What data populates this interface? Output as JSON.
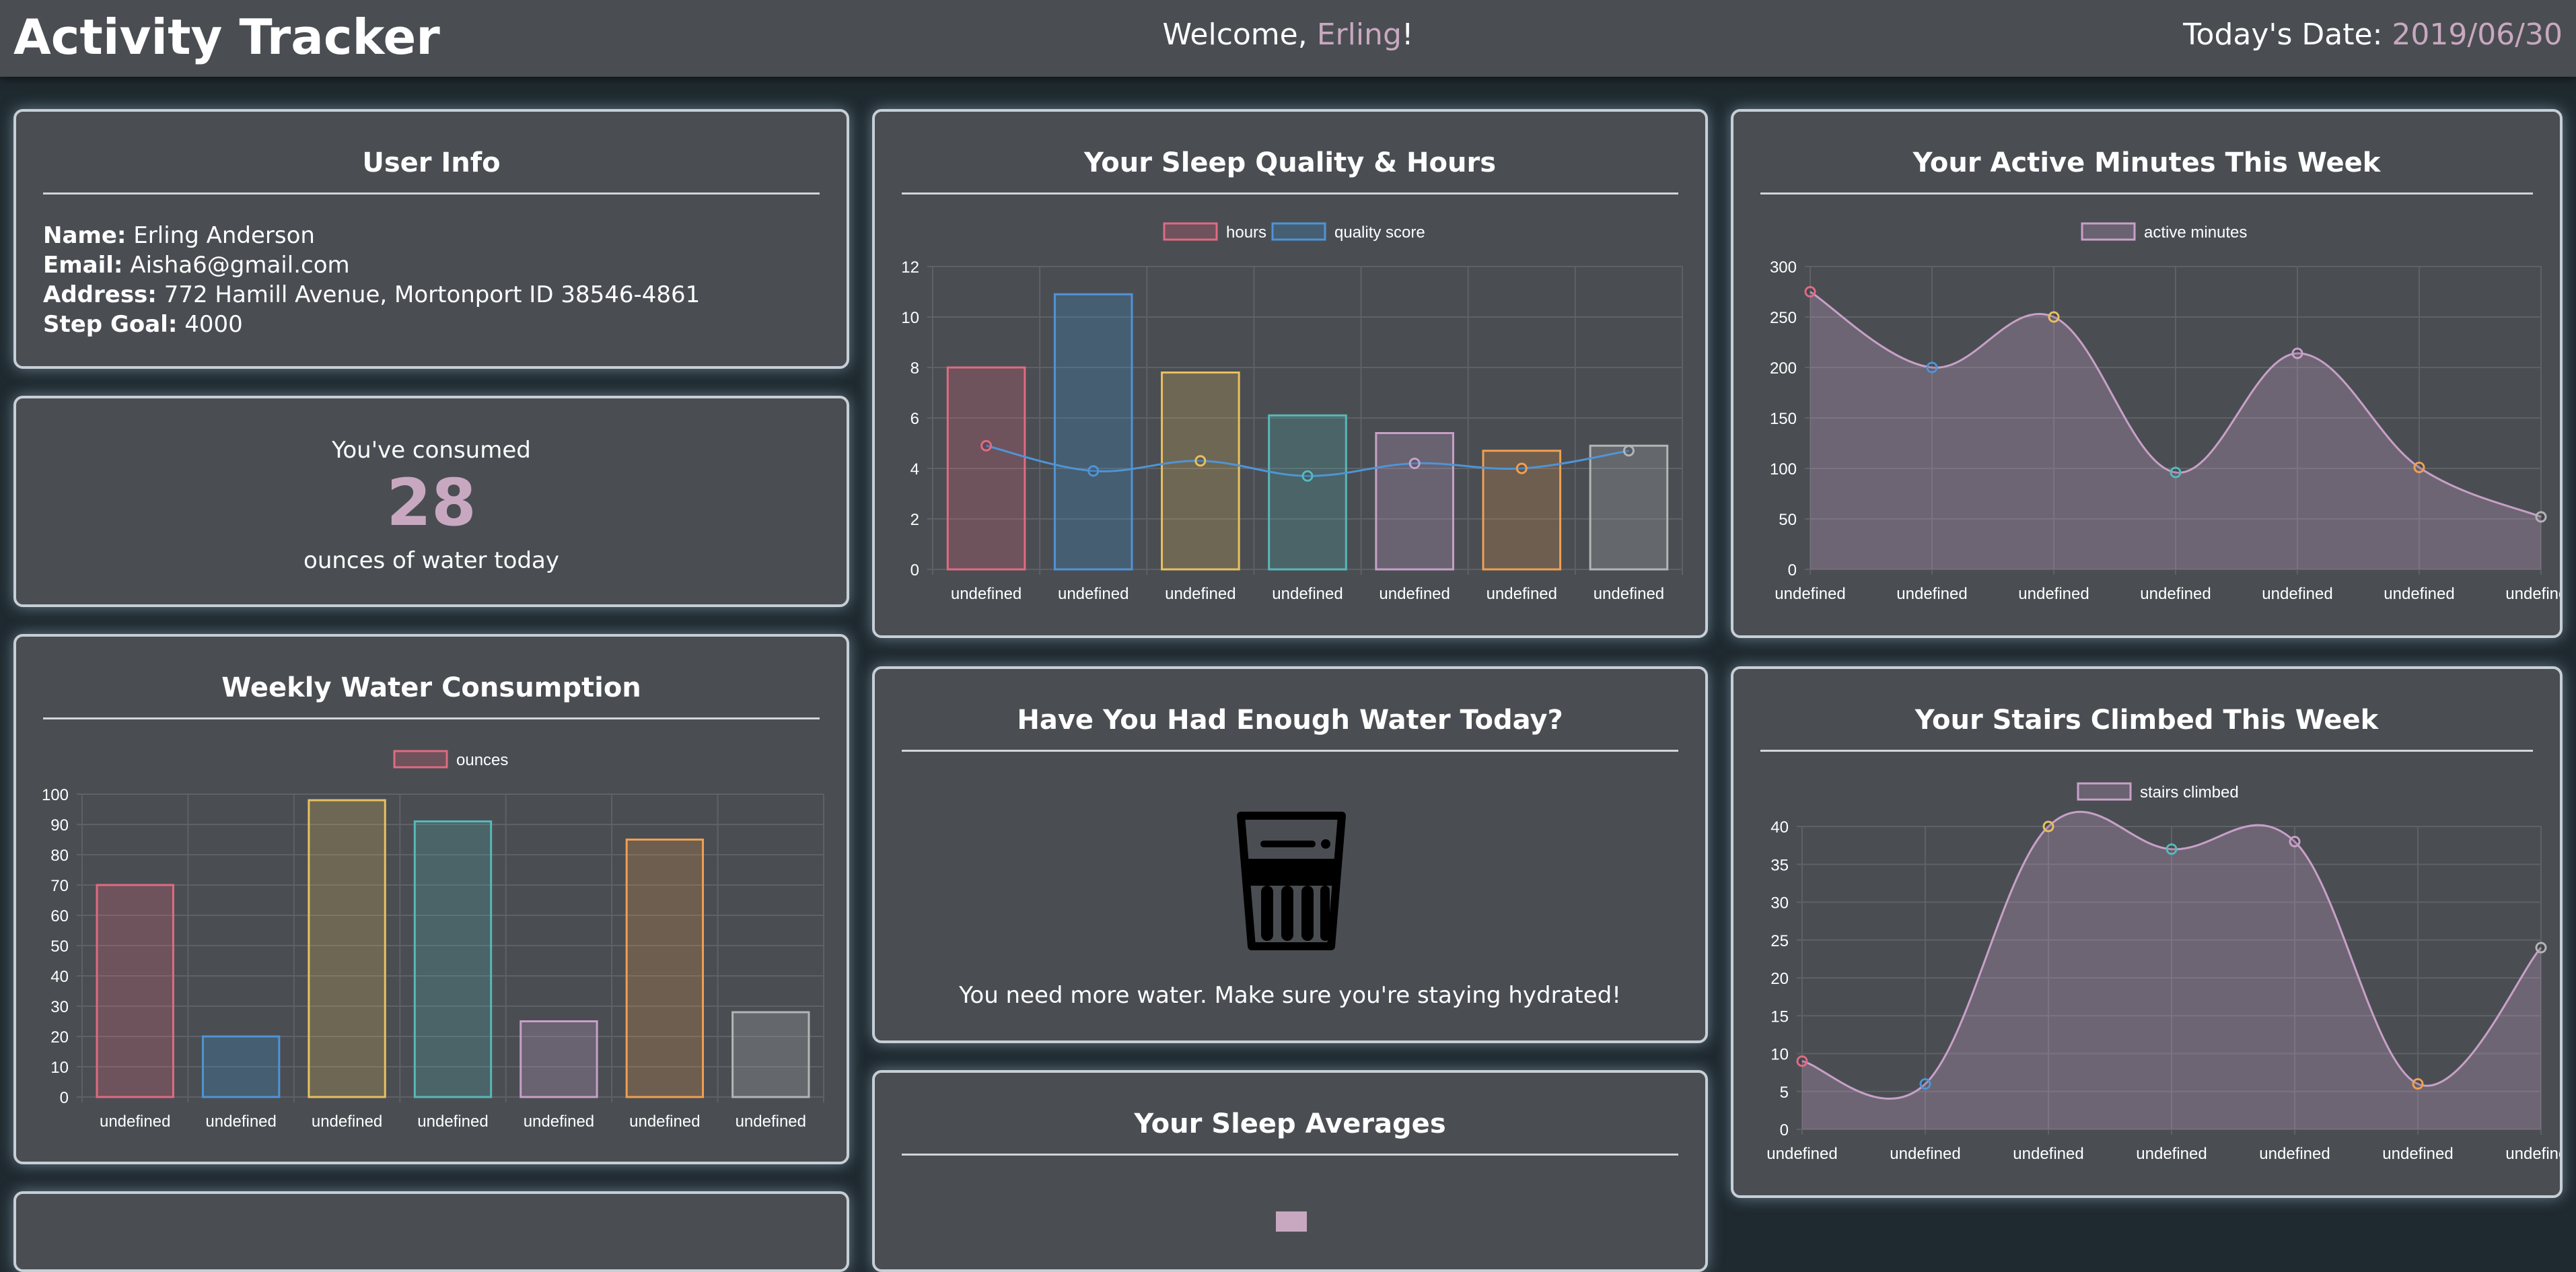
{
  "header": {
    "title": "Activity Tracker",
    "welcome_prefix": "Welcome, ",
    "user_first_name": "Erling",
    "welcome_suffix": "!",
    "date_label": "Today's Date: ",
    "date_value": "2019/06/30"
  },
  "user_info": {
    "title": "User Info",
    "name_label": "Name:",
    "name": "Erling Anderson",
    "email_label": "Email:",
    "email": "Aisha6@gmail.com",
    "address_label": "Address:",
    "address": "772 Hamill Avenue, Mortonport ID 38546-4861",
    "step_goal_label": "Step Goal:",
    "step_goal": "4000"
  },
  "water_today": {
    "prefix": "You've consumed",
    "amount": "28",
    "suffix": "ounces of water today"
  },
  "enough_water": {
    "title": "Have You Had Enough Water Today?",
    "icon": "water-glass-icon",
    "message": "You need more water. Make sure you're staying hydrated!"
  },
  "sleep_averages": {
    "title": "Your Sleep Averages"
  },
  "palette": {
    "fills": [
      "rgba(255,99,132,0.2)",
      "rgba(54,162,235,0.2)",
      "rgba(255,206,86,0.2)",
      "rgba(75,192,192,0.2)",
      "rgba(200,160,200,0.25)",
      "rgba(255,159,64,0.2)",
      "rgba(180,180,180,0.25)"
    ],
    "strokes": [
      "#e06b82",
      "#4f94d6",
      "#e8c060",
      "#57b9b9",
      "#c8a0c8",
      "#f0a050",
      "#b4b4b4"
    ],
    "gridline": "#5e6267",
    "tick_text": "#ffffff"
  },
  "chart_data": [
    {
      "id": "weekly-water",
      "title": "Weekly Water Consumption",
      "type": "bar",
      "categories": [
        "undefined",
        "undefined",
        "undefined",
        "undefined",
        "undefined",
        "undefined",
        "undefined"
      ],
      "series": [
        {
          "name": "ounces",
          "values": [
            70,
            20,
            98,
            91,
            25,
            85,
            28
          ]
        }
      ],
      "ylim": [
        0,
        100
      ],
      "yticks": [
        0,
        10,
        20,
        30,
        40,
        50,
        60,
        70,
        80,
        90,
        100
      ],
      "grid": true,
      "legend": "top-center"
    },
    {
      "id": "sleep-quality-hours",
      "title": "Your Sleep Quality & Hours",
      "type": "bar",
      "categories": [
        "undefined",
        "undefined",
        "undefined",
        "undefined",
        "undefined",
        "undefined",
        "undefined"
      ],
      "series": [
        {
          "name": "hours",
          "type": "bar",
          "values": [
            8.0,
            10.9,
            7.8,
            6.1,
            5.4,
            4.7,
            4.9
          ]
        },
        {
          "name": "quality score",
          "type": "line",
          "values": [
            4.9,
            3.9,
            4.3,
            3.7,
            4.2,
            4.0,
            4.7
          ]
        }
      ],
      "ylim": [
        0,
        12
      ],
      "yticks": [
        0,
        2,
        4,
        6,
        8,
        10,
        12
      ],
      "grid": true,
      "legend": "top-center"
    },
    {
      "id": "active-minutes",
      "title": "Your Active Minutes This Week",
      "type": "area",
      "categories": [
        "undefined",
        "undefined",
        "undefined",
        "undefined",
        "undefined",
        "undefined",
        "undefined"
      ],
      "series": [
        {
          "name": "active minutes",
          "values": [
            275,
            200,
            250,
            96,
            214,
            101,
            52
          ]
        }
      ],
      "ylim": [
        0,
        300
      ],
      "yticks": [
        0,
        50,
        100,
        150,
        200,
        250,
        300
      ],
      "grid": true,
      "legend": "top-center"
    },
    {
      "id": "stairs-climbed",
      "title": "Your Stairs Climbed This Week",
      "type": "area",
      "categories": [
        "undefined",
        "undefined",
        "undefined",
        "undefined",
        "undefined",
        "undefined",
        "undefined"
      ],
      "series": [
        {
          "name": "stairs climbed",
          "values": [
            9,
            6,
            40,
            37,
            38,
            6,
            24
          ]
        }
      ],
      "ylim": [
        0,
        40
      ],
      "yticks": [
        0,
        5,
        10,
        15,
        20,
        25,
        30,
        35,
        40
      ],
      "grid": true,
      "legend": "top-center"
    }
  ]
}
